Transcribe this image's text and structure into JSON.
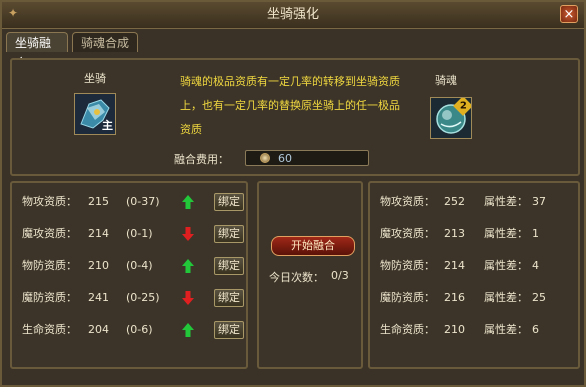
{
  "window": {
    "title": "坐骑强化",
    "close_glyph": "×"
  },
  "tabs": [
    {
      "label": "坐骑融合",
      "active": true
    },
    {
      "label": "骑魂合成",
      "active": false
    }
  ],
  "top": {
    "mount_label": "坐骑",
    "mount_badge": "主",
    "soul_label": "骑魂",
    "soul_badge": "2",
    "description": "骑魂的极品资质有一定几率的转移到坐骑资质上，也有一定几率的替换原坐骑上的任一极品资质",
    "fee_label": "融合费用：",
    "fee_value": "60",
    "fee_icon": "coin-icon"
  },
  "left_stats": [
    {
      "name": "物攻资质：",
      "value": "215",
      "range": "(0-37)",
      "trend": "up",
      "bind": "绑定"
    },
    {
      "name": "魔攻资质：",
      "value": "214",
      "range": "(0-1)",
      "trend": "down",
      "bind": "绑定"
    },
    {
      "name": "物防资质：",
      "value": "210",
      "range": "(0-4)",
      "trend": "up",
      "bind": "绑定"
    },
    {
      "name": "魔防资质：",
      "value": "241",
      "range": "(0-25)",
      "trend": "down",
      "bind": "绑定"
    },
    {
      "name": "生命资质：",
      "value": "204",
      "range": "(0-6)",
      "trend": "up",
      "bind": "绑定"
    }
  ],
  "middle": {
    "start_button": "开始融合",
    "today_label": "今日次数：",
    "today_value": "0/3"
  },
  "right_stats": [
    {
      "name": "物攻资质：",
      "value": "252",
      "diff_label": "属性差：",
      "diff": "37"
    },
    {
      "name": "魔攻资质：",
      "value": "213",
      "diff_label": "属性差：",
      "diff": "1"
    },
    {
      "name": "物防资质：",
      "value": "214",
      "diff_label": "属性差：",
      "diff": "4"
    },
    {
      "name": "魔防资质：",
      "value": "216",
      "diff_label": "属性差：",
      "diff": "25"
    },
    {
      "name": "生命资质：",
      "value": "210",
      "diff_label": "属性差：",
      "diff": "6"
    }
  ],
  "colors": {
    "up_arrow": "#22c83a",
    "down_arrow": "#e02020",
    "desc_text": "#f0d840"
  }
}
